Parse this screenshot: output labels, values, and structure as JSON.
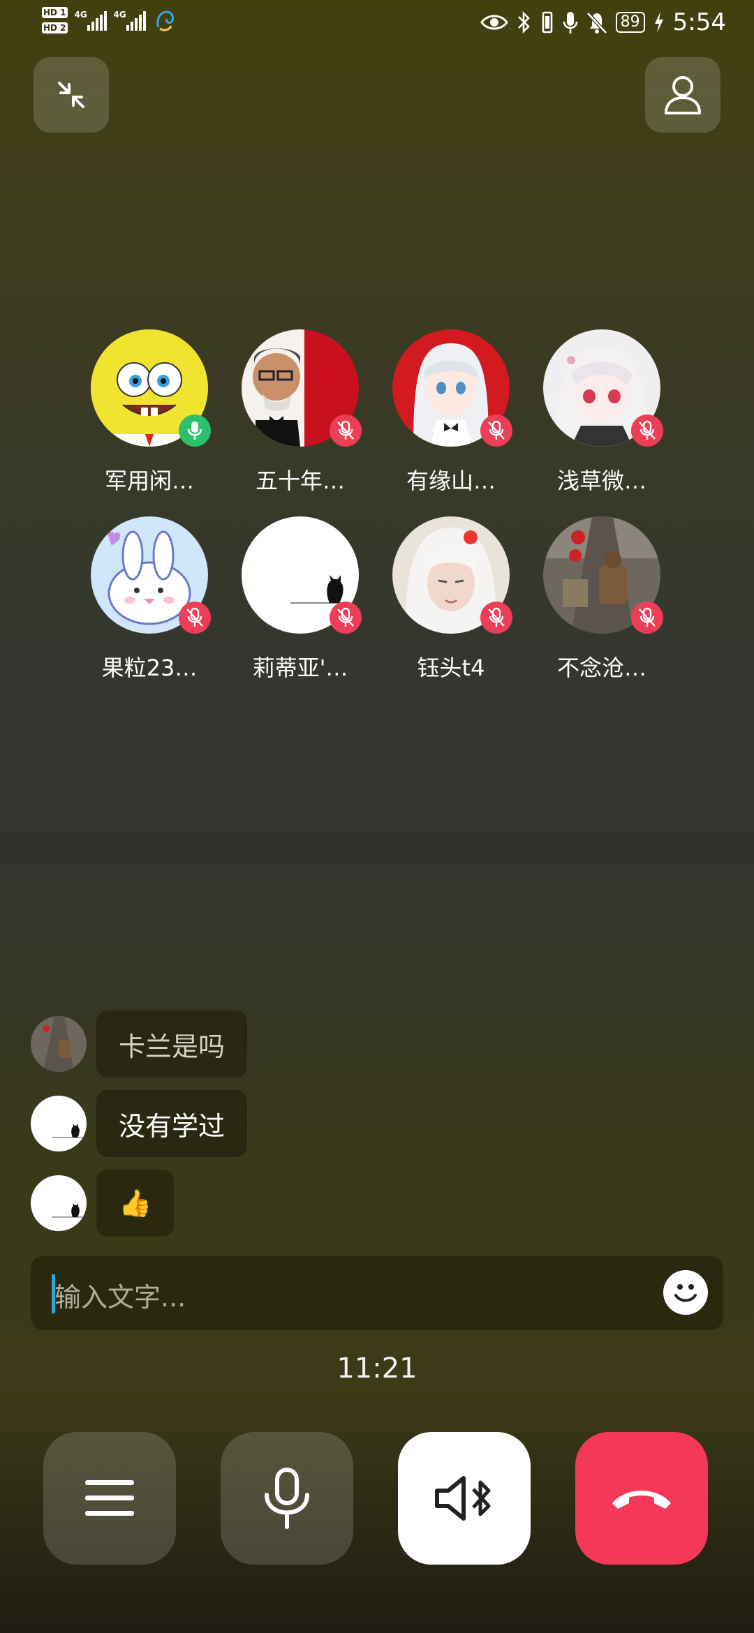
{
  "status_bar": {
    "sim1": "HD 1",
    "sim2": "HD 2",
    "network1": "4G",
    "network2": "4G",
    "battery": "89",
    "time": "5:54"
  },
  "top": {
    "minimize_icon": "shrink-arrows-icon",
    "profile_icon": "person-icon"
  },
  "participants": [
    {
      "name": "军用闲…",
      "mic": "on"
    },
    {
      "name": "五十年…",
      "mic": "off"
    },
    {
      "name": "有缘山…",
      "mic": "off"
    },
    {
      "name": "浅草微…",
      "mic": "off"
    },
    {
      "name": "果粒23…",
      "mic": "off"
    },
    {
      "name": "莉蒂亚'…",
      "mic": "off"
    },
    {
      "name": "钰头t4",
      "mic": "off"
    },
    {
      "name": "不念沧…",
      "mic": "off"
    }
  ],
  "chat": {
    "messages": [
      {
        "text": "卡兰是吗"
      },
      {
        "text": "没有学过"
      },
      {
        "text": "👍"
      }
    ],
    "input_placeholder": "输入文字..."
  },
  "call_timer": "11:21",
  "controls": [
    "menu-icon",
    "microphone-icon",
    "speaker-bluetooth-icon",
    "hang-up-icon"
  ],
  "colors": {
    "mic_on": "#2cc16a",
    "mic_off": "#ec3e56",
    "hang_up": "#f4385a",
    "cursor": "#2aa6d9"
  }
}
